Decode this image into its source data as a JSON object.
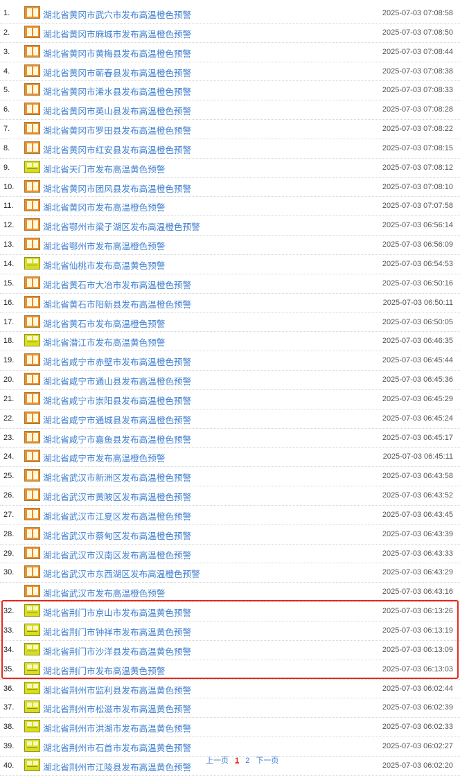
{
  "alerts": [
    {
      "num": "1.",
      "title": "湖北省黄冈市武穴市发布高温橙色预警",
      "time": "2025-07-03 07:08:58",
      "level": "orange"
    },
    {
      "num": "2.",
      "title": "湖北省黄冈市麻城市发布高温橙色预警",
      "time": "2025-07-03 07:08:50",
      "level": "orange"
    },
    {
      "num": "3.",
      "title": "湖北省黄冈市黄梅县发布高温橙色预警",
      "time": "2025-07-03 07:08:44",
      "level": "orange"
    },
    {
      "num": "4.",
      "title": "湖北省黄冈市蕲春县发布高温橙色预警",
      "time": "2025-07-03 07:08:38",
      "level": "orange"
    },
    {
      "num": "5.",
      "title": "湖北省黄冈市浠水县发布高温橙色预警",
      "time": "2025-07-03 07:08:33",
      "level": "orange"
    },
    {
      "num": "6.",
      "title": "湖北省黄冈市英山县发布高温橙色预警",
      "time": "2025-07-03 07:08:28",
      "level": "orange"
    },
    {
      "num": "7.",
      "title": "湖北省黄冈市罗田县发布高温橙色预警",
      "time": "2025-07-03 07:08:22",
      "level": "orange"
    },
    {
      "num": "8.",
      "title": "湖北省黄冈市红安县发布高温橙色预警",
      "time": "2025-07-03 07:08:15",
      "level": "orange"
    },
    {
      "num": "9.",
      "title": "湖北省天门市发布高温黄色预警",
      "time": "2025-07-03 07:08:12",
      "level": "yellow"
    },
    {
      "num": "10.",
      "title": "湖北省黄冈市团风县发布高温橙色预警",
      "time": "2025-07-03 07:08:10",
      "level": "orange"
    },
    {
      "num": "11.",
      "title": "湖北省黄冈市发布高温橙色预警",
      "time": "2025-07-03 07:07:58",
      "level": "orange"
    },
    {
      "num": "12.",
      "title": "湖北省鄂州市梁子湖区发布高温橙色预警",
      "time": "2025-07-03 06:56:14",
      "level": "orange"
    },
    {
      "num": "13.",
      "title": "湖北省鄂州市发布高温橙色预警",
      "time": "2025-07-03 06:56:09",
      "level": "orange"
    },
    {
      "num": "14.",
      "title": "湖北省仙桃市发布高温黄色预警",
      "time": "2025-07-03 06:54:53",
      "level": "yellow"
    },
    {
      "num": "15.",
      "title": "湖北省黄石市大冶市发布高温橙色预警",
      "time": "2025-07-03 06:50:16",
      "level": "orange"
    },
    {
      "num": "16.",
      "title": "湖北省黄石市阳新县发布高温橙色预警",
      "time": "2025-07-03 06:50:11",
      "level": "orange"
    },
    {
      "num": "17.",
      "title": "湖北省黄石市发布高温橙色预警",
      "time": "2025-07-03 06:50:05",
      "level": "orange"
    },
    {
      "num": "18.",
      "title": "湖北省潜江市发布高温黄色预警",
      "time": "2025-07-03 06:46:35",
      "level": "yellow"
    },
    {
      "num": "19.",
      "title": "湖北省咸宁市赤壁市发布高温橙色预警",
      "time": "2025-07-03 06:45:44",
      "level": "orange"
    },
    {
      "num": "20.",
      "title": "湖北省咸宁市通山县发布高温橙色预警",
      "time": "2025-07-03 06:45:36",
      "level": "orange"
    },
    {
      "num": "21.",
      "title": "湖北省咸宁市崇阳县发布高温橙色预警",
      "time": "2025-07-03 06:45:29",
      "level": "orange"
    },
    {
      "num": "22.",
      "title": "湖北省咸宁市通城县发布高温橙色预警",
      "time": "2025-07-03 06:45:24",
      "level": "orange"
    },
    {
      "num": "23.",
      "title": "湖北省咸宁市嘉鱼县发布高温橙色预警",
      "time": "2025-07-03 06:45:17",
      "level": "orange"
    },
    {
      "num": "24.",
      "title": "湖北省咸宁市发布高温橙色预警",
      "time": "2025-07-03 06:45:11",
      "level": "orange"
    },
    {
      "num": "25.",
      "title": "湖北省武汉市新洲区发布高温橙色预警",
      "time": "2025-07-03 06:43:58",
      "level": "orange"
    },
    {
      "num": "26.",
      "title": "湖北省武汉市黄陂区发布高温橙色预警",
      "time": "2025-07-03 06:43:52",
      "level": "orange"
    },
    {
      "num": "27.",
      "title": "湖北省武汉市江夏区发布高温橙色预警",
      "time": "2025-07-03 06:43:45",
      "level": "orange"
    },
    {
      "num": "28.",
      "title": "湖北省武汉市蔡甸区发布高温橙色预警",
      "time": "2025-07-03 06:43:39",
      "level": "orange"
    },
    {
      "num": "29.",
      "title": "湖北省武汉市汉南区发布高温橙色预警",
      "time": "2025-07-03 06:43:33",
      "level": "orange"
    },
    {
      "num": "30.",
      "title": "湖北省武汉市东西湖区发布高温橙色预警",
      "time": "2025-07-03 06:43:29",
      "level": "orange"
    },
    {
      "num": "",
      "title": "湖北省武汉市发布高温橙色预警",
      "time": "2025-07-03 06:43:16",
      "level": "orange"
    },
    {
      "num": "32.",
      "title": "湖北省荆门市京山市发布高温黄色预警",
      "time": "2025-07-03 06:13:26",
      "level": "yellow"
    },
    {
      "num": "33.",
      "title": "湖北省荆门市钟祥市发布高温黄色预警",
      "time": "2025-07-03 06:13:19",
      "level": "yellow"
    },
    {
      "num": "34.",
      "title": "湖北省荆门市沙洋县发布高温黄色预警",
      "time": "2025-07-03 06:13:09",
      "level": "yellow"
    },
    {
      "num": "35.",
      "title": "湖北省荆门市发布高温黄色预警",
      "time": "2025-07-03 06:13:03",
      "level": "yellow"
    },
    {
      "num": "36.",
      "title": "湖北省荆州市监利县发布高温黄色预警",
      "time": "2025-07-03 06:02:44",
      "level": "yellow"
    },
    {
      "num": "37.",
      "title": "湖北省荆州市松滋市发布高温黄色预警",
      "time": "2025-07-03 06:02:39",
      "level": "yellow"
    },
    {
      "num": "38.",
      "title": "湖北省荆州市洪湖市发布高温黄色预警",
      "time": "2025-07-03 06:02:33",
      "level": "yellow"
    },
    {
      "num": "39.",
      "title": "湖北省荆州市石首市发布高温黄色预警",
      "time": "2025-07-03 06:02:27",
      "level": "yellow"
    },
    {
      "num": "40.",
      "title": "湖北省荆州市江陵县发布高温黄色预警",
      "time": "2025-07-03 06:02:20",
      "level": "yellow"
    }
  ],
  "pager": {
    "prev": "上一页",
    "page1": "1",
    "page2": "2",
    "next": "下一页"
  },
  "colors": {
    "orange_icon": "#f08d2c",
    "yellow_icon": "#d8de1a",
    "link": "#3f7fd0",
    "highlight": "#e8281e"
  }
}
